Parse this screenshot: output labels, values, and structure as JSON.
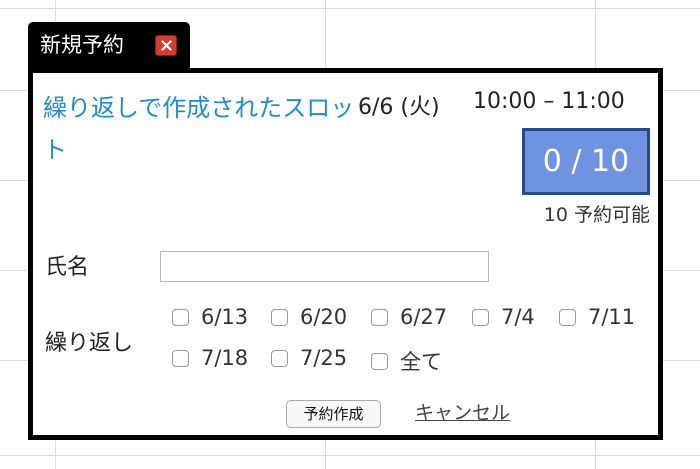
{
  "dialog": {
    "tab_title": "新規予約",
    "slot_title": "繰り返しで作成されたスロット",
    "date": "6/6 (火)",
    "time": "10:00 – 11:00",
    "capacity": "0 / 10",
    "availability": "10 予約可能",
    "name_label": "氏名",
    "name_value": "",
    "repeat_label": "繰り返し",
    "repeat_options": [
      "6/13",
      "6/20",
      "6/27",
      "7/4",
      "7/11",
      "7/18",
      "7/25",
      "全て"
    ],
    "submit_label": "予約作成",
    "cancel_label": "キャンセル"
  },
  "colors": {
    "accent_link": "#1f8bd0",
    "capacity_fill": "#6f92e1",
    "capacity_border": "#274a8f",
    "close_button": "#d73a2f"
  }
}
